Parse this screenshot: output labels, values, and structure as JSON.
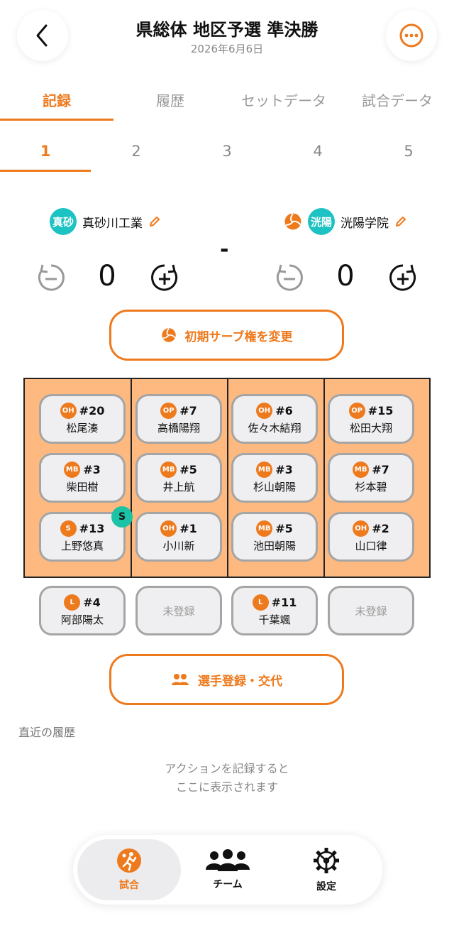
{
  "header": {
    "title": "県総体 地区予選 準決勝",
    "date": "2026年6月6日"
  },
  "tabs": [
    {
      "label": "記録",
      "active": true
    },
    {
      "label": "履歴",
      "active": false
    },
    {
      "label": "セットデータ",
      "active": false
    },
    {
      "label": "試合データ",
      "active": false
    }
  ],
  "sets": [
    "1",
    "2",
    "3",
    "4",
    "5"
  ],
  "scoreboard": {
    "home": {
      "badge": "真砂",
      "name": "真砂川工業",
      "score": "0"
    },
    "away": {
      "badge": "洸陽",
      "name": "洸陽学院",
      "score": "0"
    },
    "separator": "-"
  },
  "serve_button_label": "初期サーブ権を変更",
  "court": {
    "rows": [
      [
        {
          "pos": "OH",
          "num": "#20",
          "name": "松尾湊"
        },
        {
          "pos": "OP",
          "num": "#7",
          "name": "高橋陽翔"
        },
        {
          "pos": "OH",
          "num": "#6",
          "name": "佐々木結翔"
        },
        {
          "pos": "OP",
          "num": "#15",
          "name": "松田大翔"
        }
      ],
      [
        {
          "pos": "MB",
          "num": "#3",
          "name": "柴田樹"
        },
        {
          "pos": "MB",
          "num": "#5",
          "name": "井上航"
        },
        {
          "pos": "MB",
          "num": "#3",
          "name": "杉山朝陽"
        },
        {
          "pos": "MB",
          "num": "#7",
          "name": "杉本碧"
        }
      ],
      [
        {
          "pos": "S",
          "num": "#13",
          "name": "上野悠真"
        },
        {
          "pos": "OH",
          "num": "#1",
          "name": "小川新"
        },
        {
          "pos": "MB",
          "num": "#5",
          "name": "池田朝陽"
        },
        {
          "pos": "OH",
          "num": "#2",
          "name": "山口律"
        }
      ]
    ],
    "server_badge": "S"
  },
  "libero": [
    {
      "pos": "L",
      "num": "#4",
      "name": "阿部陽太"
    },
    {
      "empty": "未登録"
    },
    {
      "pos": "L",
      "num": "#11",
      "name": "千葉颯"
    },
    {
      "empty": "未登録"
    }
  ],
  "register_button_label": "選手登録・交代",
  "history": {
    "label": "直近の履歴",
    "empty_line1": "アクションを記録すると",
    "empty_line2": "ここに表示されます"
  },
  "tabbar": {
    "items": [
      {
        "label": "試合",
        "icon": "volleyball-player-icon",
        "active": true
      },
      {
        "label": "チーム",
        "icon": "team-icon",
        "active": false
      },
      {
        "label": "設定",
        "icon": "gear-icon",
        "active": false
      }
    ]
  },
  "colors": {
    "accent": "#ee7a1e",
    "team_badge": "#1dc2c2",
    "court": "#fdb97f",
    "server": "#1cc2a6"
  }
}
